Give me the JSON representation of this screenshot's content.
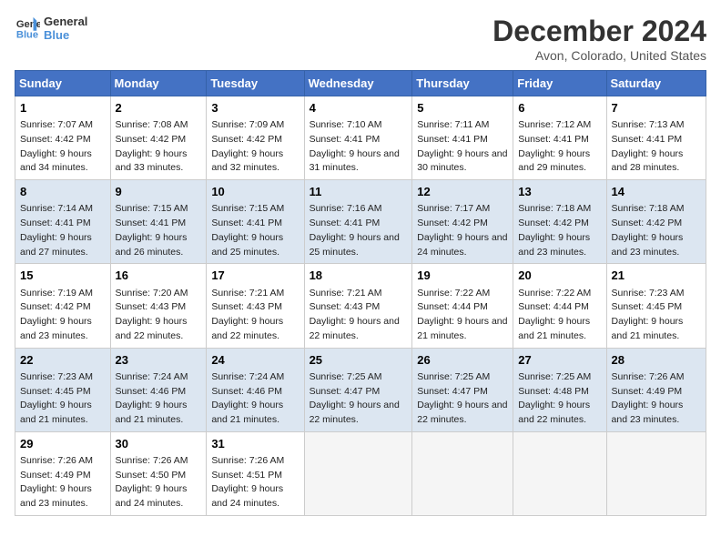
{
  "logo": {
    "line1": "General",
    "line2": "Blue"
  },
  "title": "December 2024",
  "subtitle": "Avon, Colorado, United States",
  "days_of_week": [
    "Sunday",
    "Monday",
    "Tuesday",
    "Wednesday",
    "Thursday",
    "Friday",
    "Saturday"
  ],
  "weeks": [
    [
      {
        "day": "1",
        "sunrise": "7:07 AM",
        "sunset": "4:42 PM",
        "daylight": "9 hours and 34 minutes."
      },
      {
        "day": "2",
        "sunrise": "7:08 AM",
        "sunset": "4:42 PM",
        "daylight": "9 hours and 33 minutes."
      },
      {
        "day": "3",
        "sunrise": "7:09 AM",
        "sunset": "4:42 PM",
        "daylight": "9 hours and 32 minutes."
      },
      {
        "day": "4",
        "sunrise": "7:10 AM",
        "sunset": "4:41 PM",
        "daylight": "9 hours and 31 minutes."
      },
      {
        "day": "5",
        "sunrise": "7:11 AM",
        "sunset": "4:41 PM",
        "daylight": "9 hours and 30 minutes."
      },
      {
        "day": "6",
        "sunrise": "7:12 AM",
        "sunset": "4:41 PM",
        "daylight": "9 hours and 29 minutes."
      },
      {
        "day": "7",
        "sunrise": "7:13 AM",
        "sunset": "4:41 PM",
        "daylight": "9 hours and 28 minutes."
      }
    ],
    [
      {
        "day": "8",
        "sunrise": "7:14 AM",
        "sunset": "4:41 PM",
        "daylight": "9 hours and 27 minutes."
      },
      {
        "day": "9",
        "sunrise": "7:15 AM",
        "sunset": "4:41 PM",
        "daylight": "9 hours and 26 minutes."
      },
      {
        "day": "10",
        "sunrise": "7:15 AM",
        "sunset": "4:41 PM",
        "daylight": "9 hours and 25 minutes."
      },
      {
        "day": "11",
        "sunrise": "7:16 AM",
        "sunset": "4:41 PM",
        "daylight": "9 hours and 25 minutes."
      },
      {
        "day": "12",
        "sunrise": "7:17 AM",
        "sunset": "4:42 PM",
        "daylight": "9 hours and 24 minutes."
      },
      {
        "day": "13",
        "sunrise": "7:18 AM",
        "sunset": "4:42 PM",
        "daylight": "9 hours and 23 minutes."
      },
      {
        "day": "14",
        "sunrise": "7:18 AM",
        "sunset": "4:42 PM",
        "daylight": "9 hours and 23 minutes."
      }
    ],
    [
      {
        "day": "15",
        "sunrise": "7:19 AM",
        "sunset": "4:42 PM",
        "daylight": "9 hours and 23 minutes."
      },
      {
        "day": "16",
        "sunrise": "7:20 AM",
        "sunset": "4:43 PM",
        "daylight": "9 hours and 22 minutes."
      },
      {
        "day": "17",
        "sunrise": "7:21 AM",
        "sunset": "4:43 PM",
        "daylight": "9 hours and 22 minutes."
      },
      {
        "day": "18",
        "sunrise": "7:21 AM",
        "sunset": "4:43 PM",
        "daylight": "9 hours and 22 minutes."
      },
      {
        "day": "19",
        "sunrise": "7:22 AM",
        "sunset": "4:44 PM",
        "daylight": "9 hours and 21 minutes."
      },
      {
        "day": "20",
        "sunrise": "7:22 AM",
        "sunset": "4:44 PM",
        "daylight": "9 hours and 21 minutes."
      },
      {
        "day": "21",
        "sunrise": "7:23 AM",
        "sunset": "4:45 PM",
        "daylight": "9 hours and 21 minutes."
      }
    ],
    [
      {
        "day": "22",
        "sunrise": "7:23 AM",
        "sunset": "4:45 PM",
        "daylight": "9 hours and 21 minutes."
      },
      {
        "day": "23",
        "sunrise": "7:24 AM",
        "sunset": "4:46 PM",
        "daylight": "9 hours and 21 minutes."
      },
      {
        "day": "24",
        "sunrise": "7:24 AM",
        "sunset": "4:46 PM",
        "daylight": "9 hours and 21 minutes."
      },
      {
        "day": "25",
        "sunrise": "7:25 AM",
        "sunset": "4:47 PM",
        "daylight": "9 hours and 22 minutes."
      },
      {
        "day": "26",
        "sunrise": "7:25 AM",
        "sunset": "4:47 PM",
        "daylight": "9 hours and 22 minutes."
      },
      {
        "day": "27",
        "sunrise": "7:25 AM",
        "sunset": "4:48 PM",
        "daylight": "9 hours and 22 minutes."
      },
      {
        "day": "28",
        "sunrise": "7:26 AM",
        "sunset": "4:49 PM",
        "daylight": "9 hours and 23 minutes."
      }
    ],
    [
      {
        "day": "29",
        "sunrise": "7:26 AM",
        "sunset": "4:49 PM",
        "daylight": "9 hours and 23 minutes."
      },
      {
        "day": "30",
        "sunrise": "7:26 AM",
        "sunset": "4:50 PM",
        "daylight": "9 hours and 24 minutes."
      },
      {
        "day": "31",
        "sunrise": "7:26 AM",
        "sunset": "4:51 PM",
        "daylight": "9 hours and 24 minutes."
      },
      null,
      null,
      null,
      null
    ]
  ],
  "labels": {
    "sunrise": "Sunrise:",
    "sunset": "Sunset:",
    "daylight": "Daylight:"
  }
}
